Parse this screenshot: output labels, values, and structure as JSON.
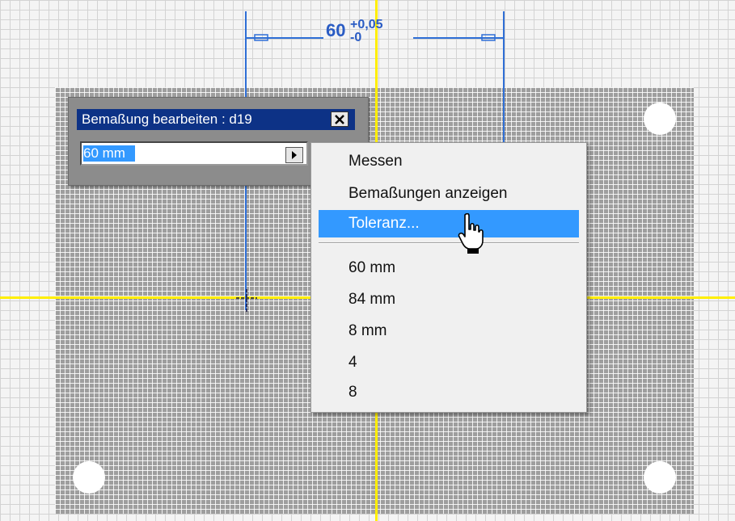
{
  "canvas": {
    "dimension": {
      "nominal": "60",
      "tolerance_upper": "+0,05",
      "tolerance_lower": "-0"
    },
    "colors": {
      "axis": "#ffee00",
      "dimension": "#2f6fd6",
      "plate": "#9e9e9e"
    }
  },
  "dialog": {
    "title": "Bemaßung bearbeiten : d19",
    "value": "60 mm",
    "close_icon": "close-icon",
    "arrow_icon": "triangle-right-icon"
  },
  "menu": {
    "items": [
      {
        "label": "Messen"
      },
      {
        "label": "Bemaßungen anzeigen"
      },
      {
        "label": "Toleranz..."
      }
    ],
    "recent_values": [
      {
        "label": "60 mm"
      },
      {
        "label": "84 mm"
      },
      {
        "label": "8 mm"
      },
      {
        "label": "4"
      },
      {
        "label": "8"
      }
    ],
    "highlight_color": "#3399ff"
  },
  "cursor_icon": "hand-pointer-icon"
}
